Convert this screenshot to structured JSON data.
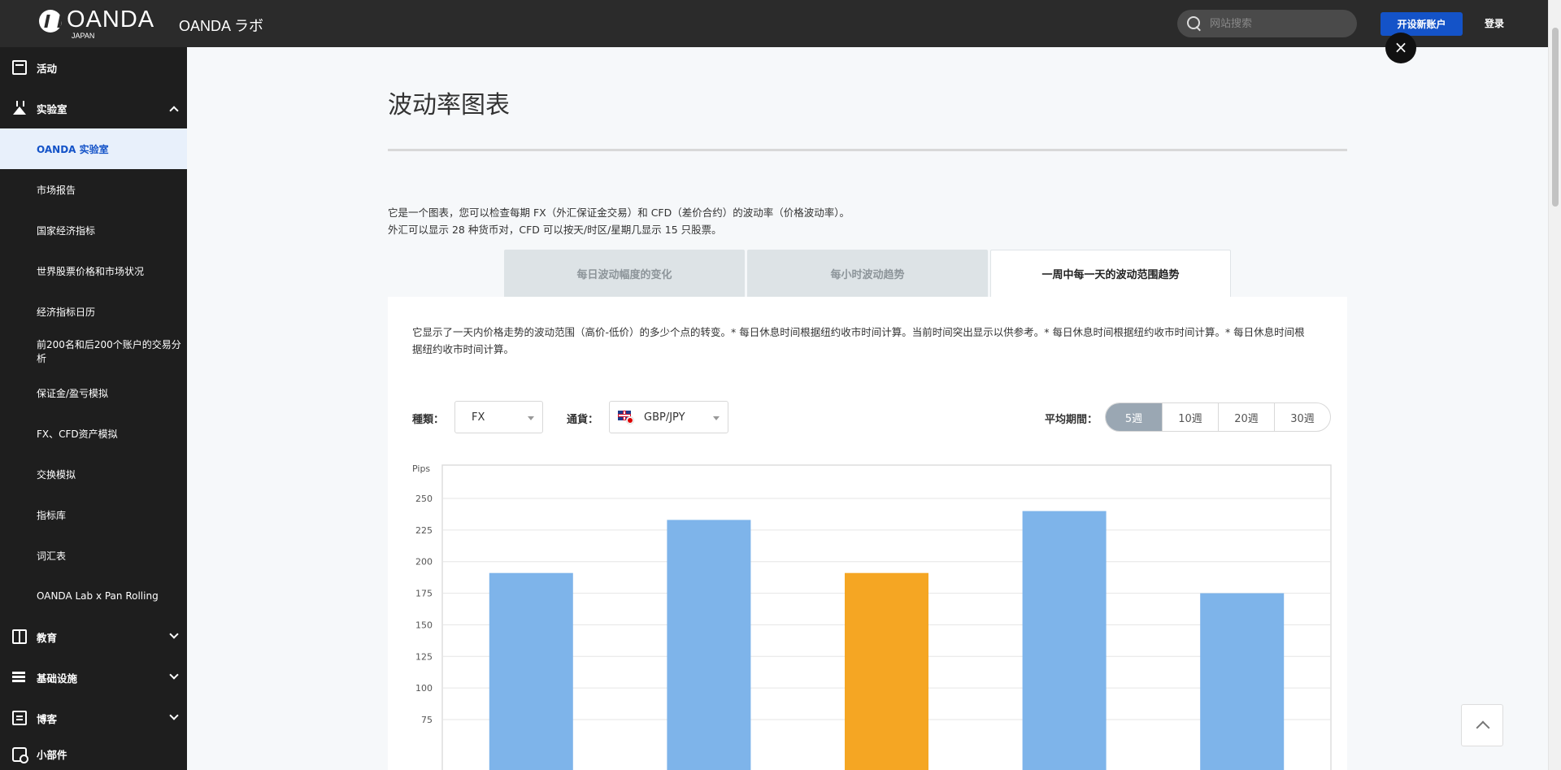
{
  "header": {
    "logo_text": "OANDA",
    "logo_sub": "JAPAN",
    "site_name": "OANDA ラボ",
    "search_placeholder": "网站搜索",
    "open_account": "开设新账户",
    "login": "登录"
  },
  "sidebar": {
    "items": [
      {
        "label": "活动",
        "icon": "calendar-icon"
      },
      {
        "label": "实验室",
        "icon": "flask-icon"
      },
      {
        "label": "OANDA 实验室"
      },
      {
        "label": "市场报告"
      },
      {
        "label": "国家经济指标"
      },
      {
        "label": "世界股票价格和市场状况"
      },
      {
        "label": "经济指标日历"
      },
      {
        "label": "前200名和后200个账户的交易分析"
      },
      {
        "label": "保证金/盈亏模拟"
      },
      {
        "label": "FX、CFD资产模拟"
      },
      {
        "label": "交换模拟"
      },
      {
        "label": "指标库"
      },
      {
        "label": "词汇表"
      },
      {
        "label": "OANDA Lab x Pan Rolling"
      },
      {
        "label": "教育",
        "icon": "book-icon"
      },
      {
        "label": "基础设施",
        "icon": "infrastructure-icon"
      },
      {
        "label": "博客",
        "icon": "blog-icon"
      },
      {
        "label": "小部件",
        "icon": "widget-icon"
      }
    ]
  },
  "main": {
    "title": "波动率图表",
    "desc_line1": "它是一个图表，您可以检查每期 FX（外汇保证金交易）和 CFD（差价合约）的波动率（价格波动率）。",
    "desc_line2": "外汇可以显示 28 种货币对，CFD 可以按天/时区/星期几显示 15 只股票。",
    "tabs": [
      {
        "label": "每日波动幅度的变化"
      },
      {
        "label": "每小时波动趋势"
      },
      {
        "label": "一周中每一天的波动范围趋势"
      }
    ],
    "panel_desc": "它显示了一天内价格走势的波动范围（高价-低价）的多少个点的转变。* 每日休息时间根据纽约收市时间计算。当前时间突出显示以供参考。* 每日休息时间根据纽约收市时间计算。* 每日休息时间根据纽约收市时间计算。",
    "type_label": "種類：",
    "type_value": "FX",
    "currency_label": "通貨：",
    "currency_value": "GBP/JPY",
    "period_label": "平均期間：",
    "periods": [
      "5週",
      "10週",
      "20週",
      "30週"
    ]
  },
  "colors": {
    "bar_default": "#7eb4ea",
    "bar_highlight": "#f5a623",
    "accent": "#1453c8"
  },
  "chart_data": {
    "type": "bar",
    "ylabel": "Pips",
    "yticks": [
      75,
      100,
      125,
      150,
      175,
      200,
      225,
      250
    ],
    "ylim": [
      0,
      275
    ],
    "values": [
      191,
      233,
      191,
      240,
      175
    ],
    "highlight_index": 2,
    "grid": true
  }
}
